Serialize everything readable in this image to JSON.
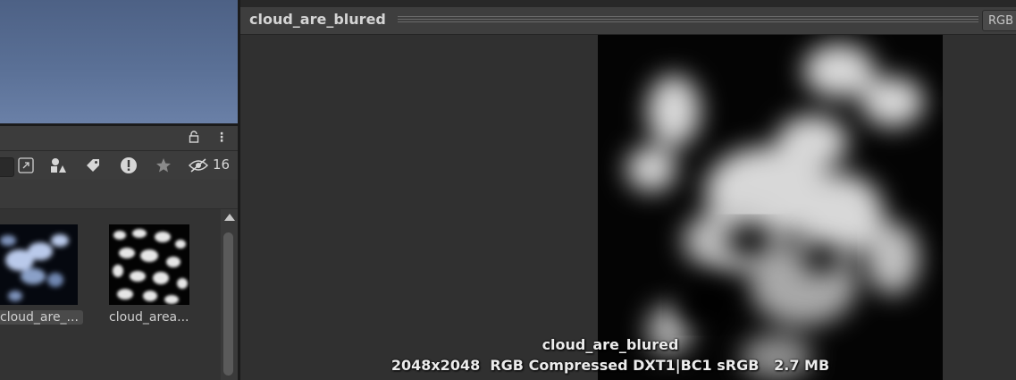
{
  "project_panel": {
    "filter_count": "16",
    "assets": [
      {
        "label": "cloud_are_..."
      },
      {
        "label": "cloud_area..."
      }
    ]
  },
  "inspector": {
    "title": "cloud_are_blured",
    "channel_button": "RGB"
  },
  "preview": {
    "name": "cloud_are_blured",
    "details": "2048x2048  RGB Compressed DXT1|BC1 sRGB   2.7 MB"
  },
  "colors": {
    "scene_sky": "#5a7096",
    "panel_bg": "#383838",
    "texture_bg": "#000000"
  }
}
